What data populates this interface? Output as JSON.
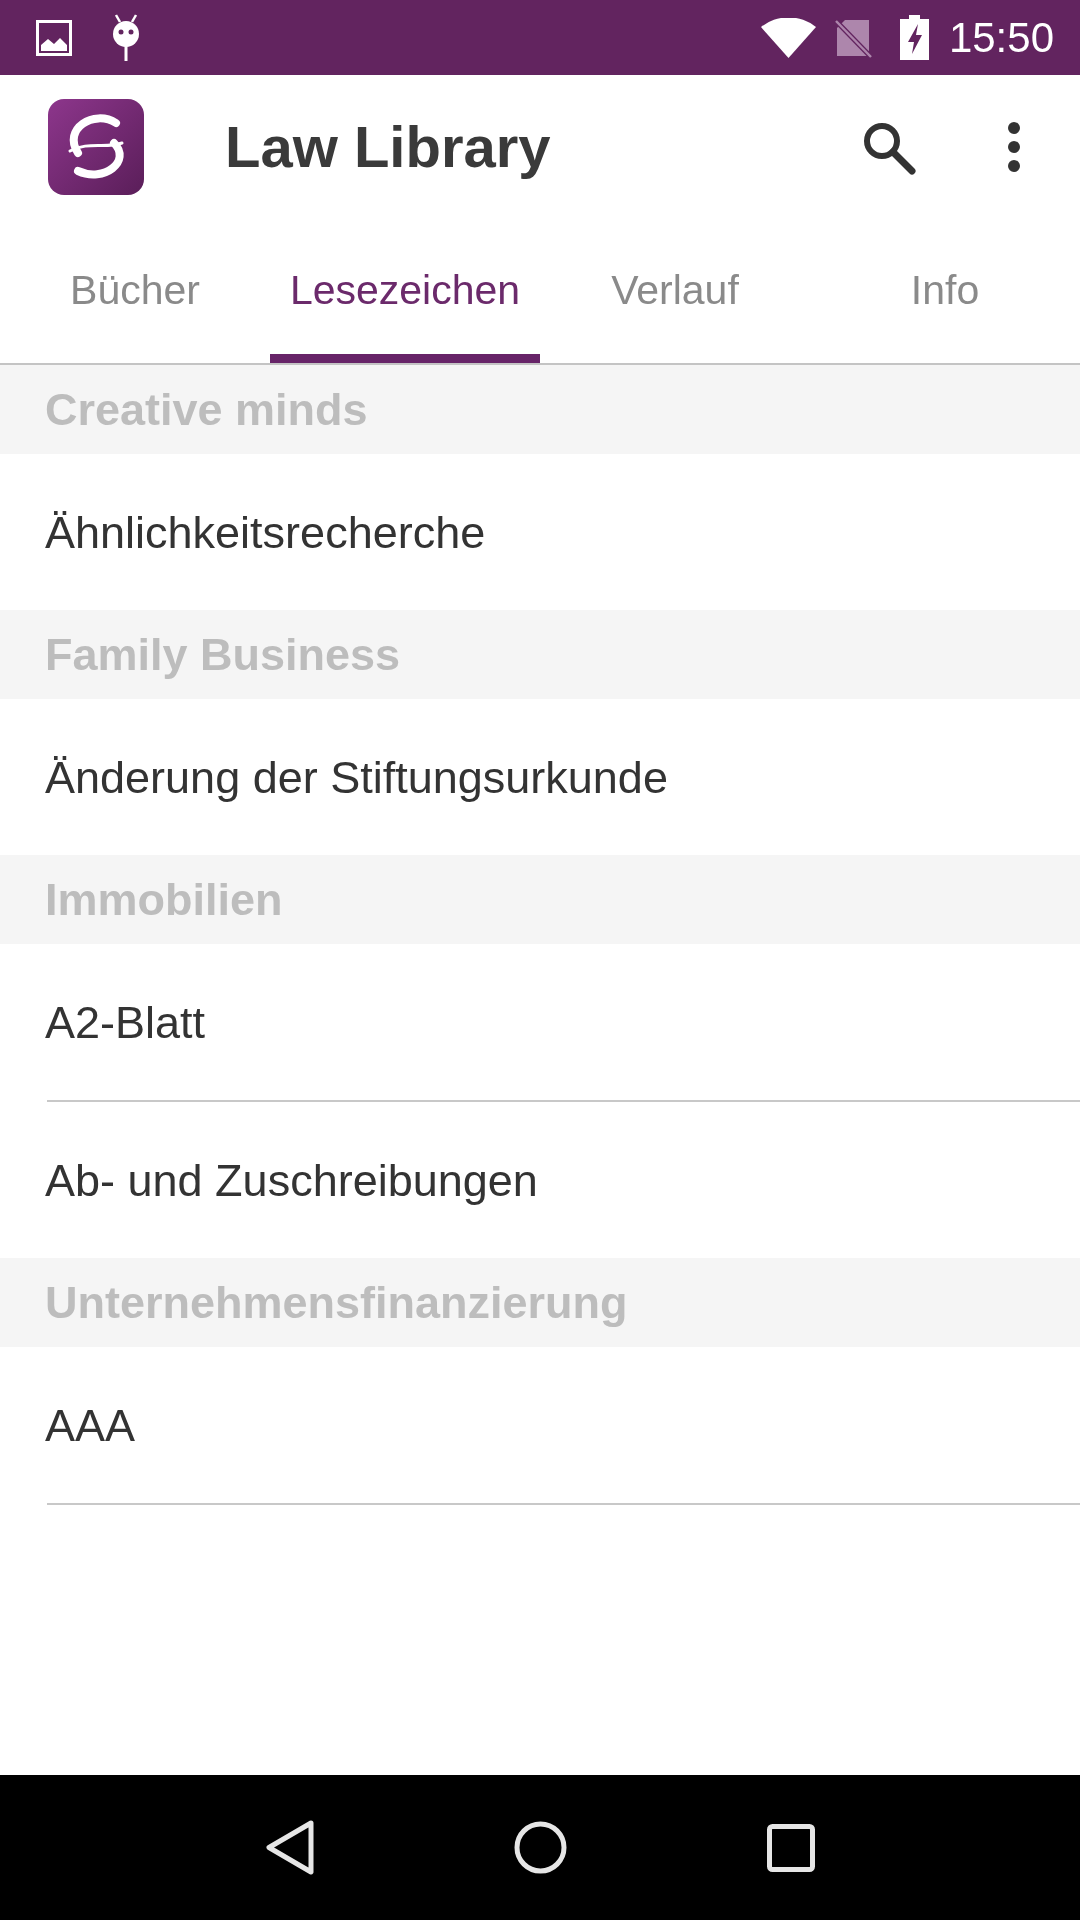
{
  "status_bar": {
    "time": "15:50"
  },
  "app_bar": {
    "title": "Law Library"
  },
  "tabs": [
    {
      "label": "Bücher",
      "selected": false
    },
    {
      "label": "Lesezeichen",
      "selected": true
    },
    {
      "label": "Verlauf",
      "selected": false
    },
    {
      "label": "Info",
      "selected": false
    }
  ],
  "bookmark_groups": [
    {
      "title": "Creative minds",
      "items": [
        "Ähnlichkeitsrecherche"
      ]
    },
    {
      "title": "Family Business",
      "items": [
        "Änderung der Stiftungsurkunde"
      ]
    },
    {
      "title": "Immobilien",
      "items": [
        "A2-Blatt",
        "Ab- und Zuschreibungen"
      ]
    },
    {
      "title": "Unternehmensfinanzierung",
      "items": [
        "AAA"
      ]
    }
  ]
}
